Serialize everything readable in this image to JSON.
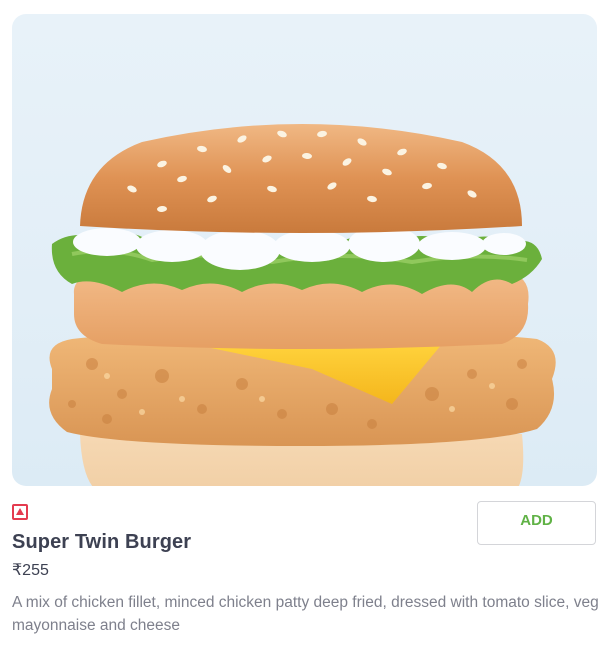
{
  "item": {
    "name": "Super Twin Burger",
    "price": "₹255",
    "description": "A mix of chicken fillet, minced chicken patty deep fried, dressed with tomato slice, veg mayonnaise and cheese",
    "food_type_icon": "non-veg-indicator-icon",
    "image": "burger-photo"
  },
  "actions": {
    "add_label": "ADD"
  },
  "colors": {
    "add_text": "#60b246",
    "non_veg_marker": "#e43b4f",
    "title_text": "#3d4152",
    "description_text": "#7e808c"
  }
}
